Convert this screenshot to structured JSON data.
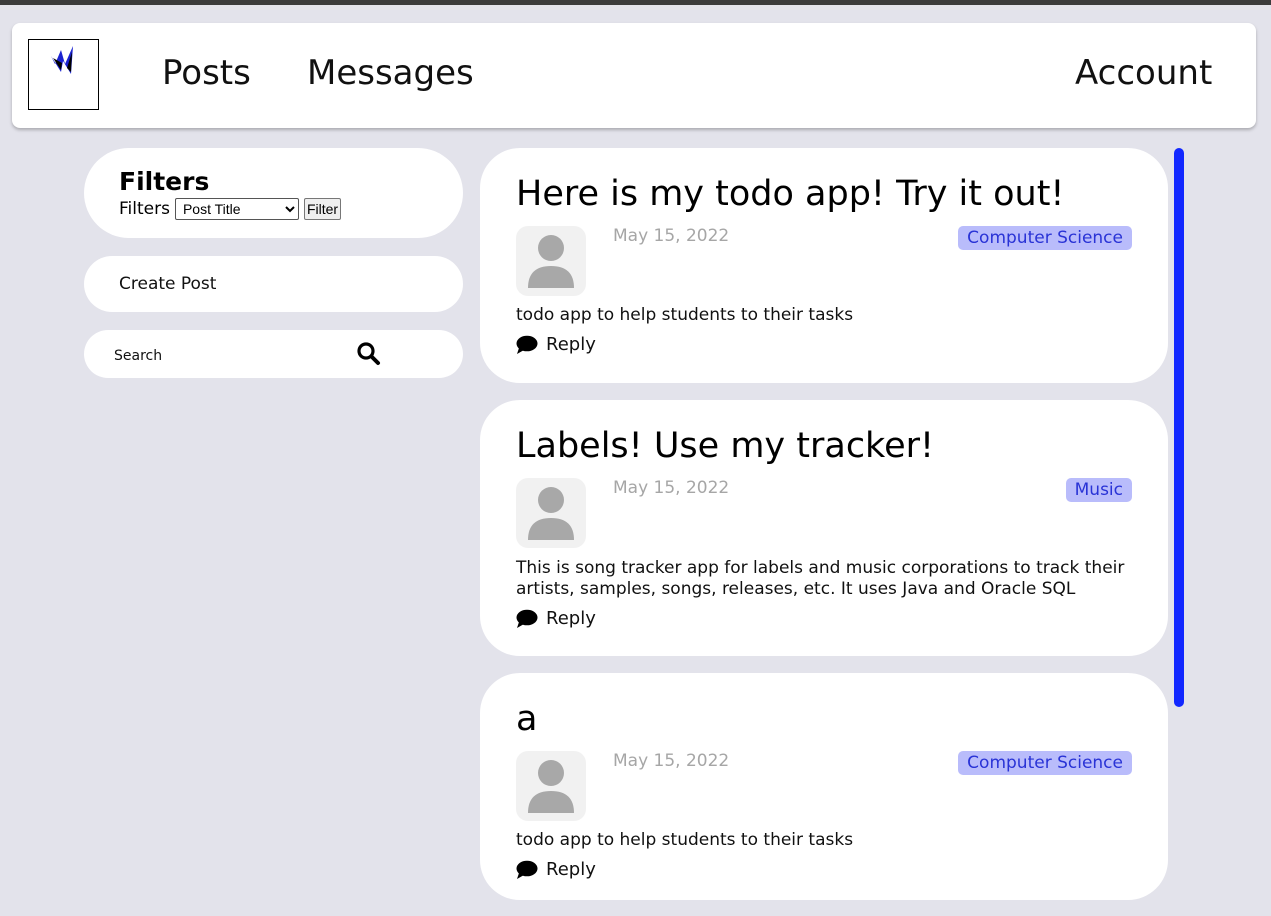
{
  "nav": {
    "posts": "Posts",
    "messages": "Messages",
    "account": "Account"
  },
  "sidebar": {
    "filters_title": "Filters",
    "filters_label": "Filters",
    "filter_select_value": "Post Title",
    "filter_button": "Filter",
    "create_post": "Create Post",
    "search_placeholder": "Search"
  },
  "posts": [
    {
      "title": "Here is my todo app! Try it out!",
      "date": "May 15, 2022",
      "tag": "Computer Science",
      "body": "todo app to help students to their tasks",
      "reply": "Reply"
    },
    {
      "title": "Labels! Use my tracker!",
      "date": "May 15, 2022",
      "tag": "Music",
      "body": "This is song tracker app for labels and music corporations to track their artists, samples, songs, releases, etc. It uses Java and Oracle SQL",
      "reply": "Reply"
    },
    {
      "title": "a",
      "date": "May 15, 2022",
      "tag": "Computer Science",
      "body": "todo app to help students to their tasks",
      "reply": "Reply"
    }
  ],
  "colors": {
    "background": "#e3e3eb",
    "accent": "#1228ff",
    "tag_bg": "#b9bcfb",
    "tag_text": "#2933d6"
  }
}
